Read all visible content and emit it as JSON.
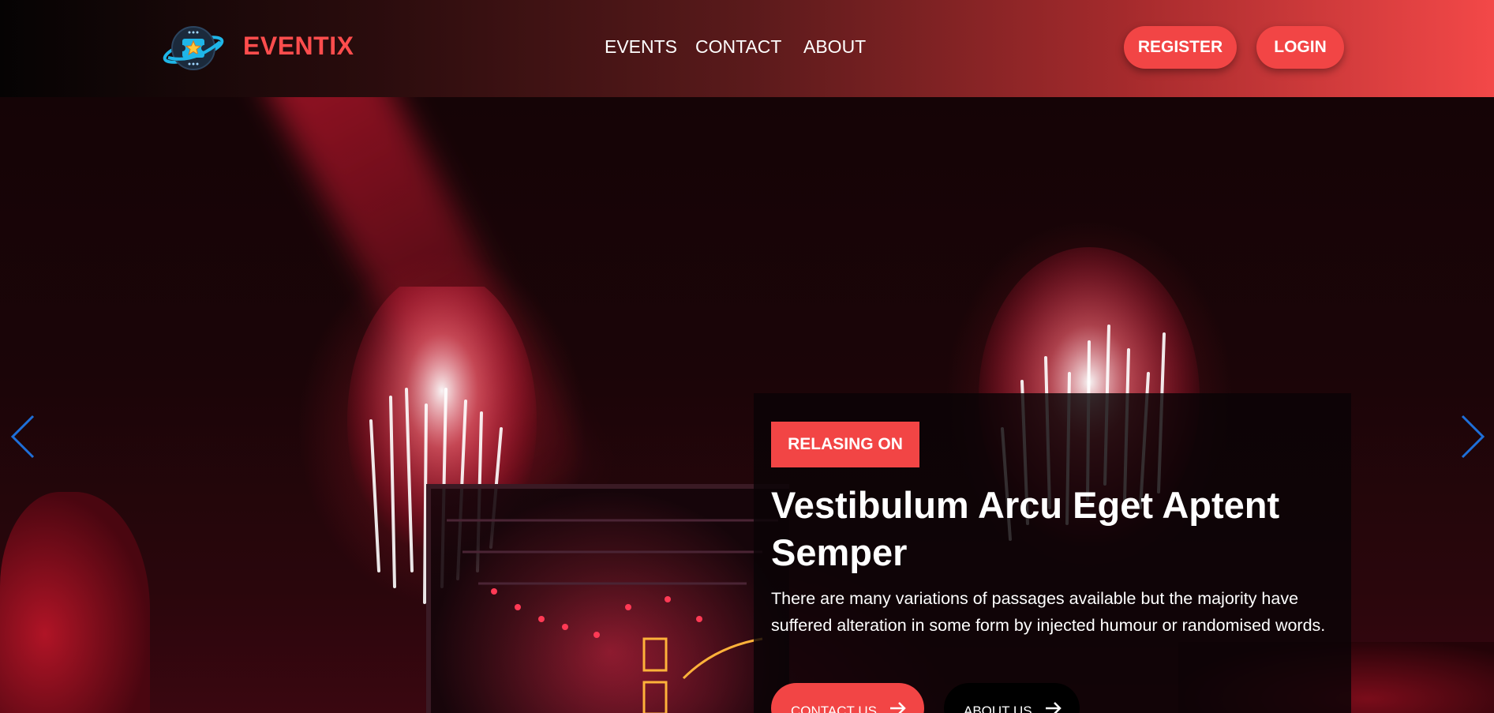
{
  "brand": {
    "name": "EVENTIX"
  },
  "nav": {
    "items": [
      "EVENTS",
      "CONTACT",
      "ABOUT"
    ]
  },
  "auth": {
    "register_label": "REGISTER",
    "login_label": "LOGIN"
  },
  "hero": {
    "badge": "RELASING ON",
    "title": "Vestibulum Arcu Eget Aptent Semper",
    "description": "There are many variations of passages available but the majority have suffered alteration in some form by injected humour or randomised words.",
    "buttons": {
      "contact_label": "CONTACT US",
      "about_label": "ABOUT US"
    }
  },
  "colors": {
    "accent": "#f24545",
    "arrow": "#1e6fd9",
    "card_bg": "#0a0406"
  },
  "icons": {
    "prev": "chevron-left-icon",
    "next": "chevron-right-icon",
    "cta": "arrow-right-icon",
    "logo": "planet-ticket-icon"
  }
}
